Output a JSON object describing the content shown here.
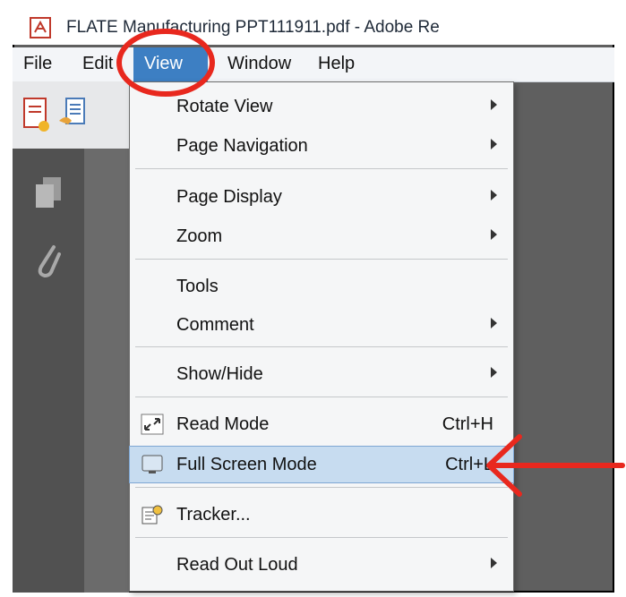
{
  "window": {
    "title": "FLATE Manufacturing PPT111911.pdf - Adobe Re"
  },
  "menubar": {
    "items": [
      "File",
      "Edit",
      "View",
      "Window",
      "Help"
    ],
    "active": "View"
  },
  "view_menu": {
    "items": [
      {
        "label": "Rotate View",
        "submenu": true
      },
      {
        "label": "Page Navigation",
        "submenu": true
      },
      {
        "label": "Page Display",
        "submenu": true
      },
      {
        "label": "Zoom",
        "submenu": true
      },
      {
        "label": "Tools",
        "submenu": false
      },
      {
        "label": "Comment",
        "submenu": true
      },
      {
        "label": "Show/Hide",
        "submenu": true
      },
      {
        "label": "Read Mode",
        "shortcut": "Ctrl+H",
        "icon": "read-mode-icon"
      },
      {
        "label": "Full Screen Mode",
        "shortcut": "Ctrl+L",
        "icon": "monitor-icon",
        "highlighted": true
      },
      {
        "label": "Tracker...",
        "icon": "tracker-icon"
      },
      {
        "label": "Read Out Loud",
        "submenu": true
      }
    ]
  },
  "colors": {
    "menu_highlight": "#3d7fc3",
    "annotation_red": "#e8281e",
    "item_highlight": "#c7dcf0"
  }
}
